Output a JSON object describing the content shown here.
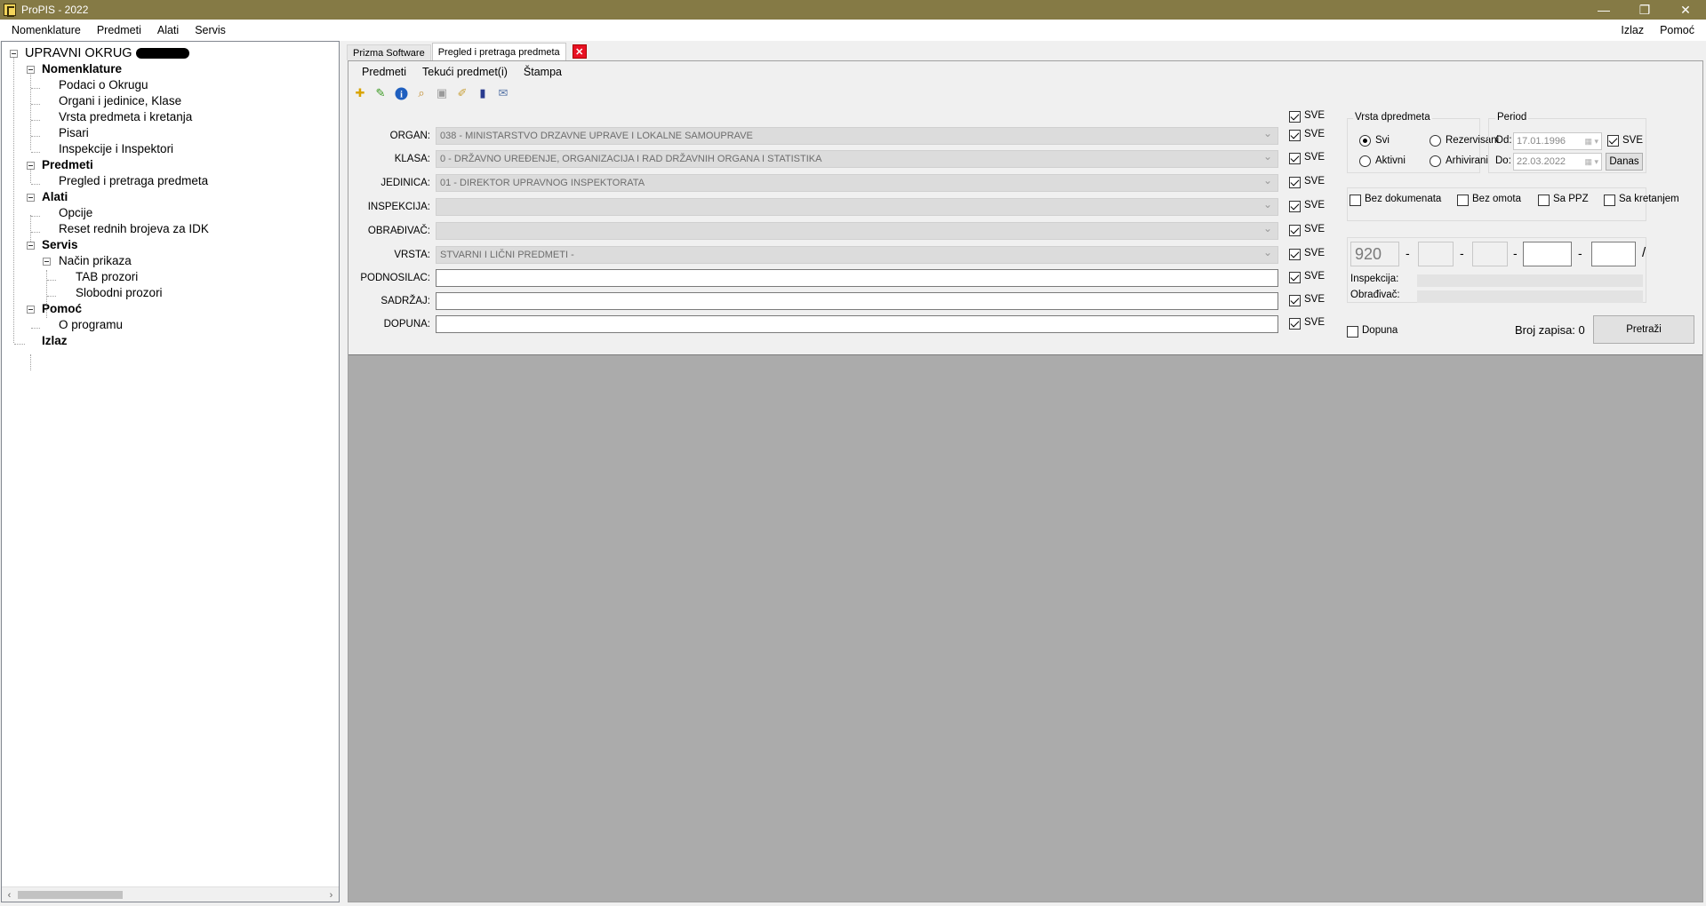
{
  "window": {
    "title": "ProPIS - 2022",
    "controls": {
      "minimize": "—",
      "restore": "❐",
      "close": "✕"
    }
  },
  "menubar": {
    "items": [
      "Nomenklature",
      "Predmeti",
      "Alati",
      "Servis"
    ],
    "right": [
      "Izlaz",
      "Pomoć"
    ]
  },
  "tree": {
    "root": "UPRAVNI OKRUG",
    "nomenklature": "Nomenklature",
    "nom_items": [
      "Podaci o Okrugu",
      "Organi i jedinice, Klase",
      "Vrsta predmeta i kretanja",
      "Pisari",
      "Inspekcije i Inspektori"
    ],
    "predmeti": "Predmeti",
    "pred_items": [
      "Pregled i pretraga predmeta"
    ],
    "alati": "Alati",
    "alati_items": [
      "Opcije",
      "Reset rednih brojeva za IDK"
    ],
    "servis": "Servis",
    "nacin": "Način prikaza",
    "nacin_items": [
      "TAB prozori",
      "Slobodni prozori"
    ],
    "pomoc": "Pomoć",
    "pomoc_items": [
      "O programu"
    ],
    "izlaz": "Izlaz"
  },
  "tabs": [
    "Prizma Software",
    "Pregled i pretraga predmeta"
  ],
  "submenu": [
    "Predmeti",
    "Tekući predmet(i)",
    "Štampa"
  ],
  "toolbar_icons": [
    "add-icon",
    "edit-icon",
    "info-icon",
    "search-docs-icon",
    "save-icon",
    "clean-icon",
    "book-icon",
    "comment-icon"
  ],
  "form": {
    "sve": "SVE",
    "organ": {
      "label": "ORGAN:",
      "value": "038   - MINISTARSTVO DRZAVNE UPRAVE I LOKALNE SAMOUPRAVE"
    },
    "klasa": {
      "label": "KLASA:",
      "value": "0      - DRŽAVNO UREĐENJE, ORGANIZACIJA I RAD DRŽAVNIH ORGANA I STATISTIKA"
    },
    "jedinica": {
      "label": "JEDINICA:",
      "value": "01    - DIREKTOR UPRAVNOG INSPEKTORATA"
    },
    "inspekcija": {
      "label": "INSPEKCIJA:",
      "value": ""
    },
    "obradjivac": {
      "label": "OBRAĐIVAČ:",
      "value": ""
    },
    "vrsta": {
      "label": "VRSTA:",
      "value": "STVARNI I LIČNI PREDMETI -"
    },
    "podnosilac": {
      "label": "PODNOSILAC:",
      "value": ""
    },
    "sadrzaj": {
      "label": "SADRŽAJ:",
      "value": ""
    },
    "dopuna": {
      "label": "DOPUNA:",
      "value": ""
    }
  },
  "vrsta_predmeta": {
    "title": "Vrsta dpredmeta",
    "svi": "Svi",
    "rezervisani": "Rezervisani",
    "aktivni": "Aktivni",
    "arhivirani": "Arhivirani"
  },
  "period": {
    "title": "Period",
    "od_label": "Od:",
    "od_value": "17.01.1996",
    "do_label": "Do:",
    "do_value": "22.03.2022",
    "sve": "SVE",
    "danas": "Danas"
  },
  "filters": [
    "Bez dokumenata",
    "Bez omota",
    "Sa PPZ",
    "Sa kretanjem"
  ],
  "number": {
    "first": "920",
    "slash": "/",
    "inspekcija_label": "Inspekcija:",
    "obradjivac_label": "Obrađivač:"
  },
  "bottom": {
    "dopuna": "Dopuna",
    "broj_zapisa": "Broj zapisa: 0",
    "pretrazi": "Pretraži"
  }
}
